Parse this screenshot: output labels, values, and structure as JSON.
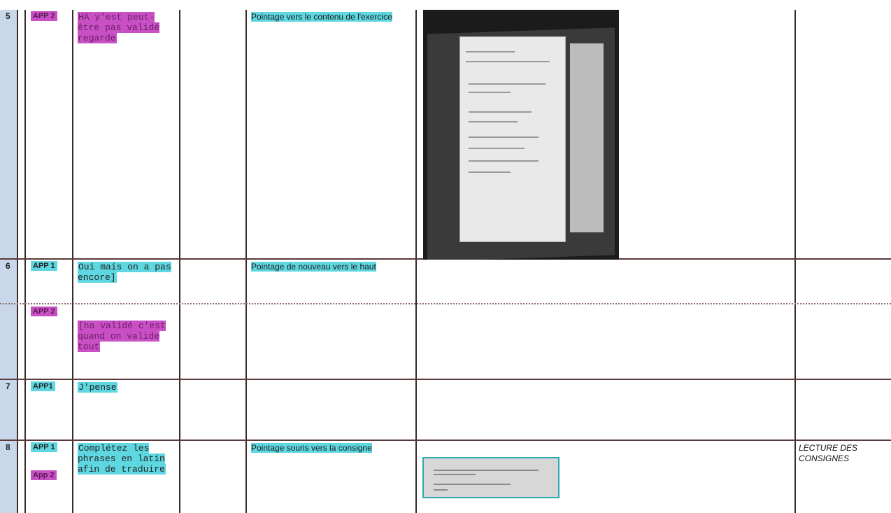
{
  "rows": [
    {
      "num": "5",
      "speaker": "APP 2",
      "transcript": "HA y'est peut-être pas validé regarde",
      "action": "Pointage vers le contenu de l'exercice"
    },
    {
      "num": "6",
      "speaker": "APP 1",
      "transcript": "Oui mais on a pas encore]",
      "action": "Pointage de nouveau vers le haut"
    },
    {
      "num": "",
      "speaker": "APP 2",
      "transcript": "[ha validé c'est quand on valide tout",
      "action": ""
    },
    {
      "num": "7",
      "speaker": "APP1",
      "transcript": "J'pense",
      "action": ""
    },
    {
      "num": "8",
      "speaker": "APP 1",
      "speaker2": "App 2",
      "transcript": "Complétez les phrases en latin afin de traduire",
      "action": "Pointage souris vers la consigne",
      "observation": "LECTURE DES CONSIGNES"
    }
  ],
  "colors": {
    "cyan_highlight": "#5fd7e0",
    "magenta_highlight": "#c94fc4",
    "row_number_strip": "#c8d8ea"
  }
}
